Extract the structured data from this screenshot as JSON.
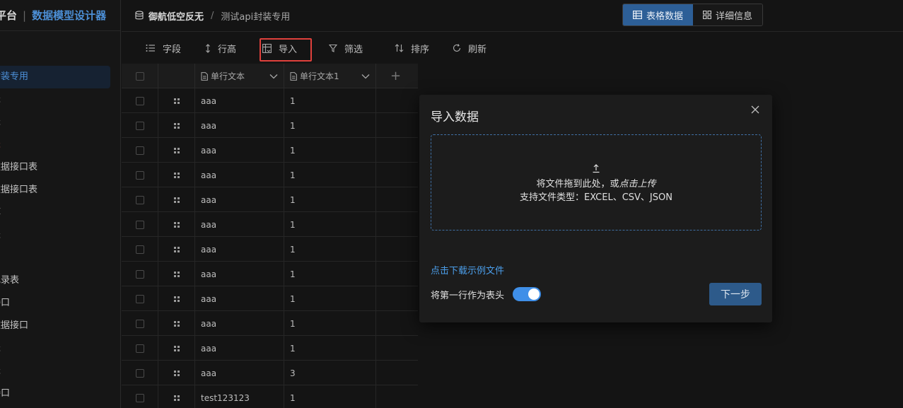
{
  "brand": {
    "platform": "平台",
    "designer": "数据模型设计器"
  },
  "sidebar": {
    "items": [
      {
        "label": "封装专用",
        "state": "active"
      },
      {
        "label": "表",
        "state": "normal"
      },
      {
        "label": "表",
        "state": "normal"
      },
      {
        "label": "表",
        "state": "red"
      },
      {
        "label": "数据接口表",
        "state": "normal"
      },
      {
        "label": "数据接口表",
        "state": "normal"
      },
      {
        "label": "库",
        "state": "normal"
      },
      {
        "label": "表",
        "state": "normal"
      },
      {
        "label": "",
        "state": "normal"
      },
      {
        "label": "记录表",
        "state": "normal"
      },
      {
        "label": "接口",
        "state": "normal"
      },
      {
        "label": "数据接口",
        "state": "normal"
      },
      {
        "label": "表",
        "state": "normal"
      },
      {
        "label": "表",
        "state": "normal"
      },
      {
        "label": "接口",
        "state": "normal"
      }
    ]
  },
  "breadcrumb": {
    "workspace": "御航低空反无",
    "current": "测试api封装专用"
  },
  "view_toggle": {
    "table_label": "表格数据",
    "detail_label": "详细信息"
  },
  "toolbar": {
    "fields": "字段",
    "row_height": "行高",
    "import": "导入",
    "filter": "筛选",
    "sort": "排序",
    "refresh": "刷新"
  },
  "table": {
    "columns": [
      "单行文本",
      "单行文本1"
    ],
    "add_column": "+",
    "rows": [
      [
        "aaa",
        "1"
      ],
      [
        "aaa",
        "1"
      ],
      [
        "aaa",
        "1"
      ],
      [
        "aaa",
        "1"
      ],
      [
        "aaa",
        "1"
      ],
      [
        "aaa",
        "1"
      ],
      [
        "aaa",
        "1"
      ],
      [
        "aaa",
        "1"
      ],
      [
        "aaa",
        "1"
      ],
      [
        "aaa",
        "1"
      ],
      [
        "aaa",
        "1"
      ],
      [
        "aaa",
        "3"
      ],
      [
        "test123123",
        "1"
      ]
    ]
  },
  "import_dialog": {
    "title": "导入数据",
    "drop_text_prefix": "将文件拖到此处，或",
    "drop_text_link": "点击上传",
    "file_types": "支持文件类型：EXCEL、CSV、JSON",
    "sample_link": "点击下载示例文件",
    "first_row_header_label": "将第一行作为表头",
    "first_row_header_on": true,
    "next_button": "下一步"
  },
  "colors": {
    "accent": "#2d5f97",
    "link": "#4b9eea",
    "highlight_border": "#e0413c"
  }
}
